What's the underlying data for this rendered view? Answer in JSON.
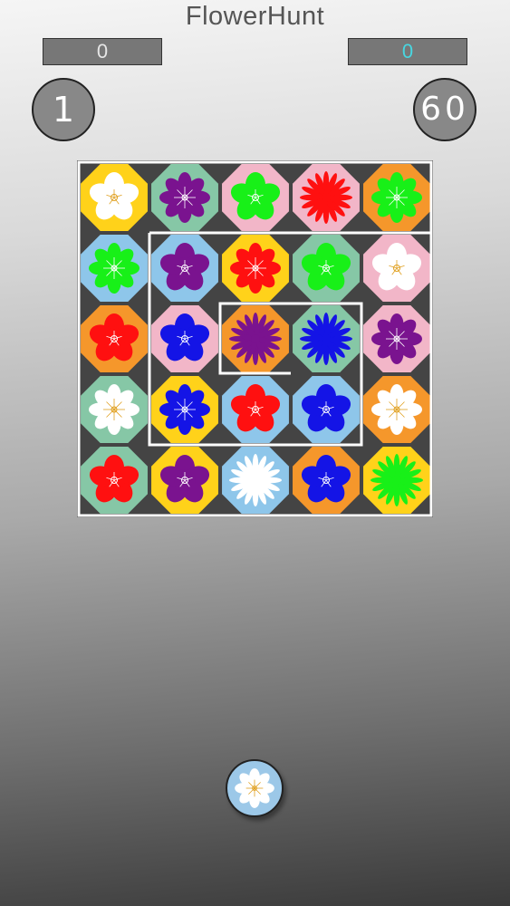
{
  "app": {
    "title": "FlowerHunt"
  },
  "hud": {
    "score_left": "0",
    "score_right": "0",
    "level": "1",
    "timer": "60"
  },
  "colors": {
    "yellow": "#ffd21a",
    "teal": "#86c7a6",
    "pink": "#f2b6c8",
    "orange": "#f5972b",
    "blue": "#8ec6ea",
    "board_bg": "#444444",
    "path": "#ffffff",
    "f_white": "#ffffff",
    "f_purple": "#7a138f",
    "f_green": "#18f018",
    "f_red": "#ff1010",
    "f_blue": "#1414e6"
  },
  "grid": [
    [
      {
        "bg": "yellow",
        "flower": "white",
        "kind": "blossom"
      },
      {
        "bg": "teal",
        "flower": "purple",
        "kind": "daisy"
      },
      {
        "bg": "pink",
        "flower": "green",
        "kind": "blossom"
      },
      {
        "bg": "pink",
        "flower": "red",
        "kind": "chrysanthemum"
      },
      {
        "bg": "orange",
        "flower": "green",
        "kind": "daisy"
      }
    ],
    [
      {
        "bg": "blue",
        "flower": "green",
        "kind": "daisy"
      },
      {
        "bg": "blue",
        "flower": "purple",
        "kind": "blossom"
      },
      {
        "bg": "yellow",
        "flower": "red",
        "kind": "daisy"
      },
      {
        "bg": "teal",
        "flower": "green",
        "kind": "blossom"
      },
      {
        "bg": "pink",
        "flower": "white",
        "kind": "blossom"
      }
    ],
    [
      {
        "bg": "orange",
        "flower": "red",
        "kind": "blossom"
      },
      {
        "bg": "pink",
        "flower": "blue",
        "kind": "blossom"
      },
      {
        "bg": "orange",
        "flower": "purple",
        "kind": "chrysanthemum"
      },
      {
        "bg": "teal",
        "flower": "blue",
        "kind": "chrysanthemum"
      },
      {
        "bg": "pink",
        "flower": "purple",
        "kind": "daisy"
      }
    ],
    [
      {
        "bg": "teal",
        "flower": "white",
        "kind": "daisy"
      },
      {
        "bg": "yellow",
        "flower": "blue",
        "kind": "daisy"
      },
      {
        "bg": "blue",
        "flower": "red",
        "kind": "blossom"
      },
      {
        "bg": "blue",
        "flower": "blue",
        "kind": "blossom"
      },
      {
        "bg": "orange",
        "flower": "white",
        "kind": "daisy"
      }
    ],
    [
      {
        "bg": "teal",
        "flower": "red",
        "kind": "blossom"
      },
      {
        "bg": "yellow",
        "flower": "purple",
        "kind": "blossom"
      },
      {
        "bg": "blue",
        "flower": "white",
        "kind": "chrysanthemum"
      },
      {
        "bg": "orange",
        "flower": "blue",
        "kind": "blossom"
      },
      {
        "bg": "yellow",
        "flower": "green",
        "kind": "chrysanthemum"
      }
    ]
  ],
  "next_piece": {
    "bg": "blue",
    "flower": "white",
    "kind": "daisy"
  }
}
